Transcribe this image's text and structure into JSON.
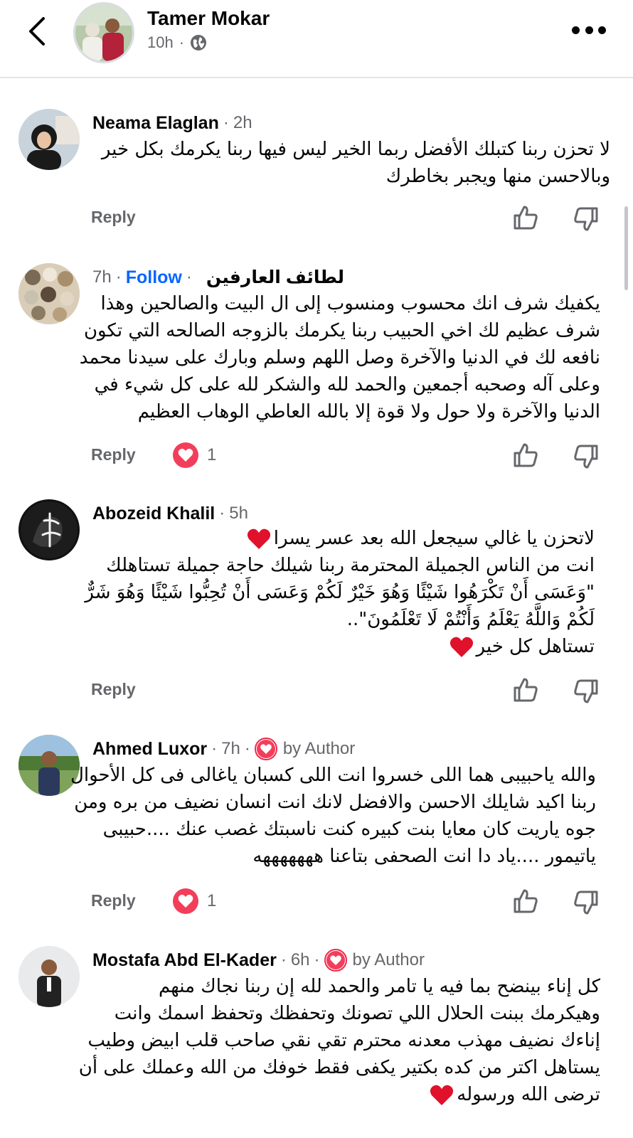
{
  "header": {
    "name": "Tamer Mokar",
    "time": "10h",
    "dot": "·"
  },
  "comments": [
    {
      "author": "Neama Elaglan",
      "time": "2h",
      "lines": [
        "لا تحزن ربنا كتبلك الأفضل ربما الخير ليس فيها ربنا يكرمك بكل خير",
        "وبالاحسن منها ويجبر بخاطرك"
      ],
      "reply_label": "Reply"
    },
    {
      "author": "لطائف العارفين",
      "time": "7h",
      "follow_label": "Follow",
      "lines": [
        "يكفيك شرف انك محسوب ومنسوب إلى ال البيت والصالحين وهذا",
        "شرف عظيم لك اخي الحبيب ربنا يكرمك بالزوجه الصالحه التي تكون",
        "نافعه لك في الدنيا والآخرة وصل اللهم وسلم وبارك على سيدنا محمد",
        "وعلى آله وصحبه أجمعين والحمد لله والشكر لله على كل شيء في",
        "الدنيا والآخرة ولا حول ولا قوة إلا بالله العاطي الوهاب العظيم"
      ],
      "reply_label": "Reply",
      "reaction_count": "1"
    },
    {
      "author": "Abozeid Khalil",
      "time": "5h",
      "lines": [
        "لاتحزن يا غالي سيجعل الله بعد عسر يسرا",
        "انت من الناس الجميلة المحترمة ربنا شيلك حاجة جميلة تستاهلك",
        "\"وَعَسَى أَنْ تَكْرَهُوا شَيْئًا وَهُوَ خَيْرٌ لَكُمْ وَعَسَى أَنْ تُحِبُّوا شَيْئًا وَهُوَ شَرٌّ",
        "لَكُمْ وَاللَّهُ يَعْلَمُ وَأَنْتُمْ لَا تَعْلَمُونَ\"..",
        "تستاهل كل خير"
      ],
      "reply_label": "Reply"
    },
    {
      "author": "Ahmed Luxor",
      "time": "7h",
      "badge_label": "by Author",
      "lines": [
        "والله ياحبيبى هما اللى خسروا انت اللى كسبان ياغالى فى كل الأحوال",
        "ربنا اكيد شايلك الاحسن والافضل لانك انت انسان نضيف من بره ومن",
        "جوه ياريت كان معايا بنت كبيره كنت ناسبتك غصب عنك ....حبيبى",
        "ياتيمور ....ياد دا انت الصحفى بتاعنا هههههههه"
      ],
      "reply_label": "Reply",
      "reaction_count": "1"
    },
    {
      "author": "Mostafa Abd El-Kader",
      "time": "6h",
      "badge_label": "by Author",
      "lines": [
        "كل إناء بينضح بما فيه يا تامر والحمد لله إن ربنا نجاك منهم",
        "وهيكرمك ببنت الحلال اللي تصونك وتحفظك وتحفظ اسمك وانت",
        "إناءك نضيف مهذب معدنه محترم تقي نقي صاحب قلب ابيض وطيب",
        "يستاهل اكتر من كده بكتير يكفى فقط خوفك من الله وعملك على أن",
        "ترضى الله ورسوله"
      ]
    }
  ],
  "colors": {
    "accent_blue": "#0866ff",
    "muted_text": "#65676b",
    "heart_red": "#f33e5b"
  },
  "icons": [
    "back-arrow-icon",
    "globe-icon",
    "more-dots-icon",
    "thumbs-up-icon",
    "thumbs-down-icon",
    "heart-icon"
  ]
}
